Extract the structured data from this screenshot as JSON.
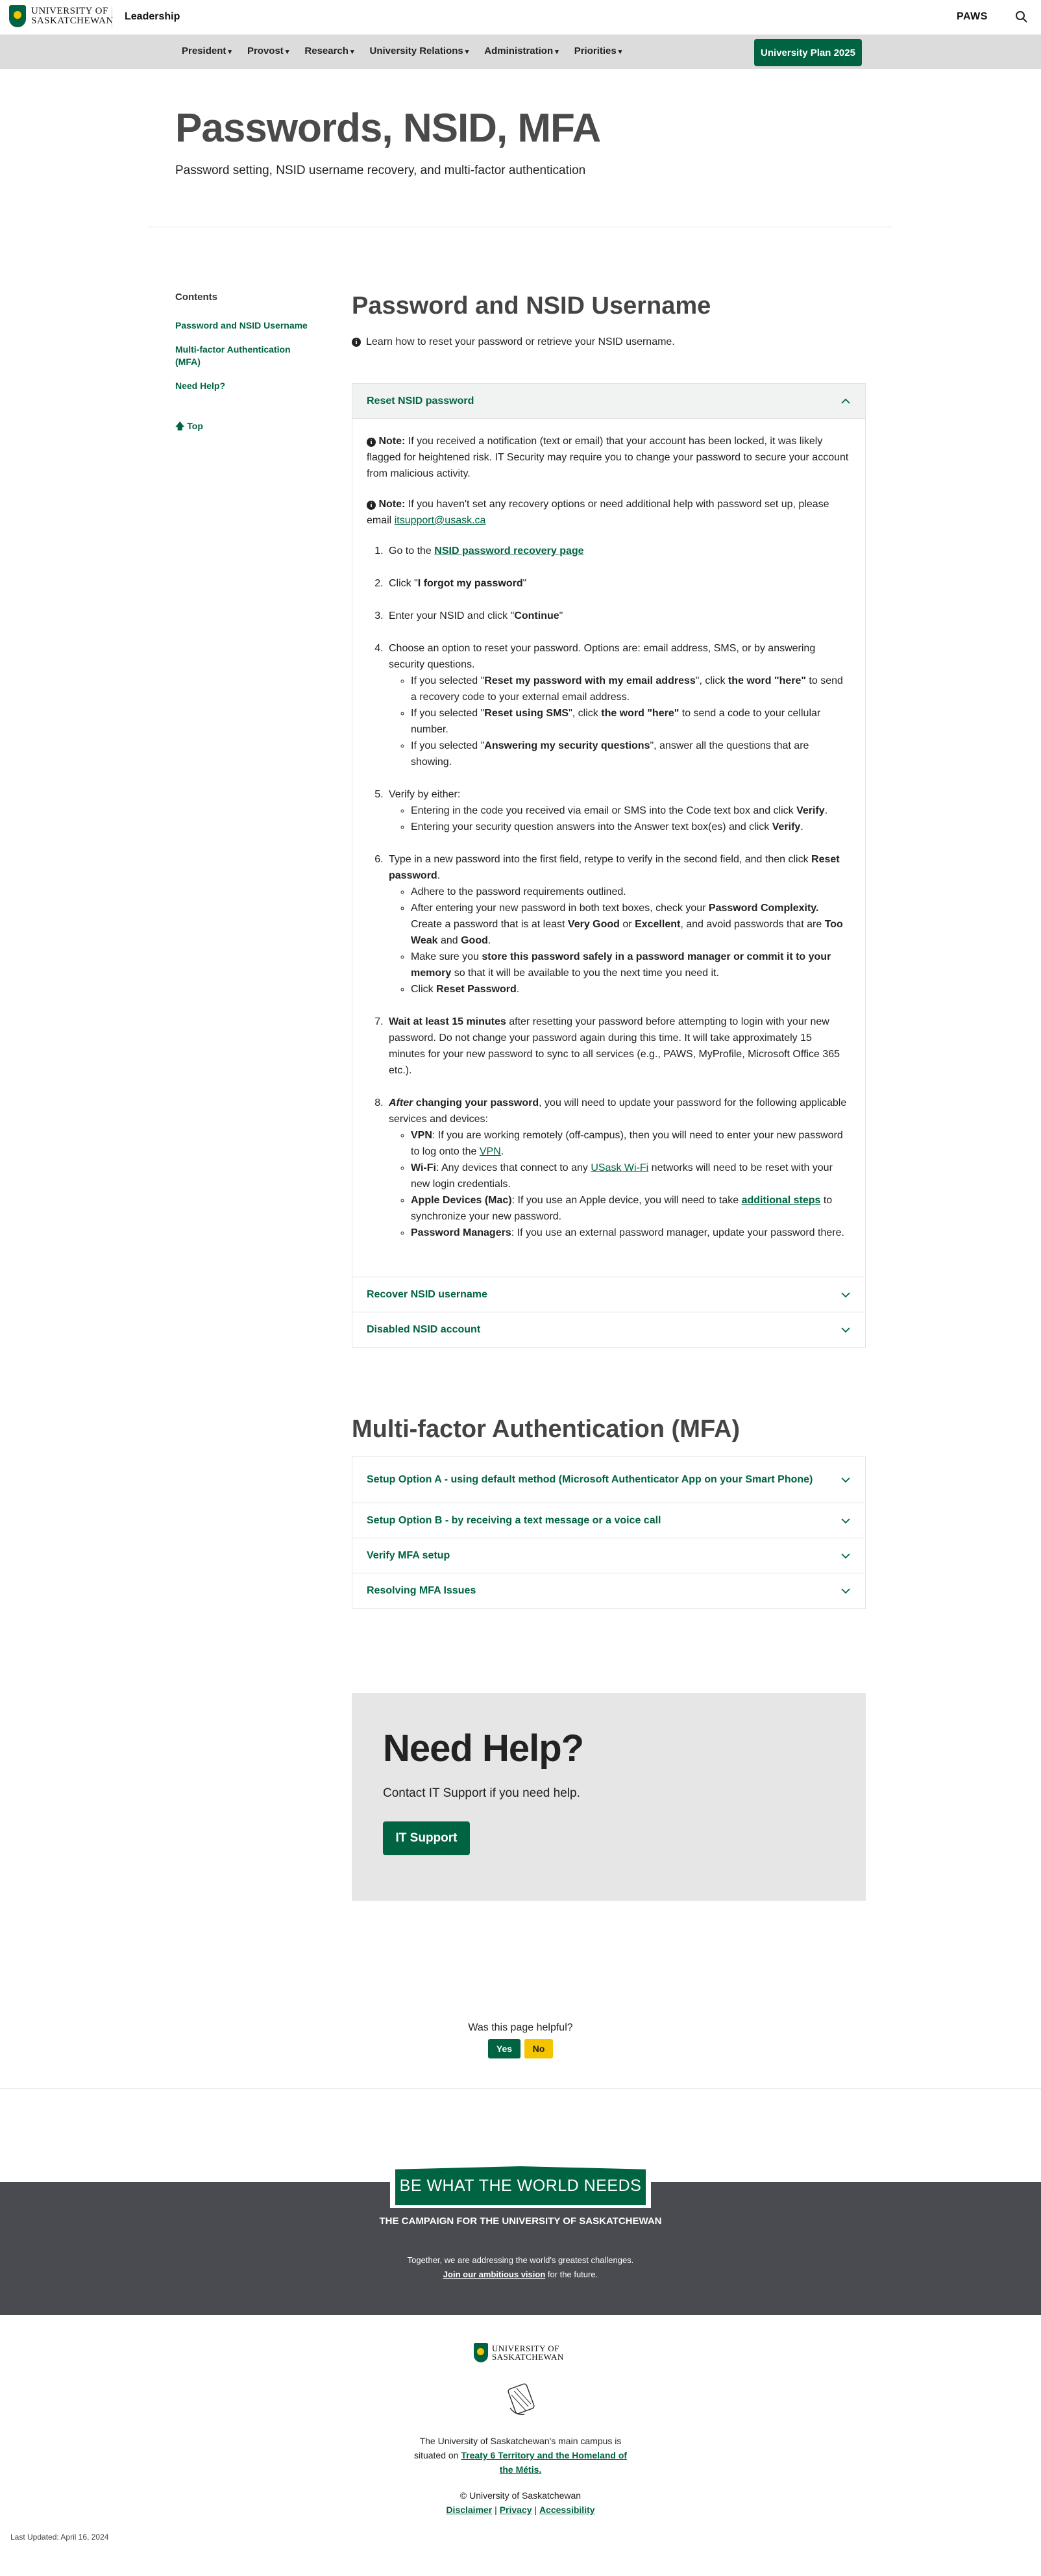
{
  "header": {
    "logo_line1": "UNIVERSITY OF",
    "logo_line2": "SASKATCHEWAN",
    "site_name": "Leadership",
    "paws_label": "PAWS"
  },
  "nav": {
    "items": [
      "President",
      "Provost",
      "Research",
      "University Relations",
      "Administration",
      "Priorities"
    ],
    "plan_button": "University Plan 2025"
  },
  "hero": {
    "title": "Passwords, NSID, MFA",
    "subtitle": "Password setting, NSID username recovery, and multi-factor authentication"
  },
  "sidebar": {
    "contents_title": "Contents",
    "links": [
      "Password and NSID Username",
      "Multi-factor Authentication (MFA)",
      "Need Help?"
    ],
    "top_label": "Top"
  },
  "section1": {
    "title": "Password and NSID Username",
    "intro": "Learn how to reset your password or retrieve your NSID username.",
    "accordion": [
      {
        "label": "Reset NSID password"
      },
      {
        "label": "Recover NSID username"
      },
      {
        "label": "Disabled NSID account"
      }
    ],
    "note1_label": "Note:",
    "note1_text": " If you received a notification (text or email) that your account has been locked, it was likely flagged for heightened risk. IT Security may require you to change your password to secure your account from malicious activity.",
    "note2_label": "Note:",
    "note2_text": " If you haven't set any recovery options or need additional help with password set up, please email ",
    "note2_email": "itsupport@usask.ca",
    "steps": {
      "s1_pre": "Go to the ",
      "s1_link": "NSID password recovery page",
      "s2_pre": "Click \"",
      "s2_bold": "I forgot my password",
      "s2_post": "\"",
      "s3_pre": "Enter your NSID and click \"",
      "s3_bold": "Continue",
      "s3_post": "\"",
      "s4_text": "Choose an option to reset your password.  Options are: email address, SMS, or by answering security questions.",
      "s4_b1_pre": "If you selected \"",
      "s4_b1_bold1": "Reset my password with my email address",
      "s4_b1_mid": "\", click ",
      "s4_b1_bold2": "the word \"here\"",
      "s4_b1_post": " to send a recovery code to your external email address.",
      "s4_b2_pre": "If you selected \"",
      "s4_b2_bold1": "Reset using SMS",
      "s4_b2_mid": "\", click ",
      "s4_b2_bold2": "the word \"here\"",
      "s4_b2_post": " to send a code to your cellular number.",
      "s4_b3_pre": "If you selected \"",
      "s4_b3_bold": "Answering my security questions",
      "s4_b3_post": "\", answer all the questions that are showing.",
      "s5_text": "Verify by either:",
      "s5_b1_pre": "Entering in the code you received via email or SMS into the Code text box and click ",
      "s5_b1_bold": "Verify",
      "s5_b1_post": ".",
      "s5_b2_pre": "Entering your security question answers into the Answer text box(es) and click ",
      "s5_b2_bold": "Verify",
      "s5_b2_post": ".",
      "s6_pre": "Type in a new password into the first field, retype to verify in the second field, and then click ",
      "s6_bold": "Reset password",
      "s6_post": ".",
      "s6_b1": "Adhere to the password requirements outlined.",
      "s6_b2_pre": "After entering your new password in both text boxes, check your ",
      "s6_b2_bold1": "Password Complexity.",
      "s6_b2_mid1": " Create a password that is at least ",
      "s6_b2_bold2": "Very Good",
      "s6_b2_mid2": " or ",
      "s6_b2_bold3": "Excellent",
      "s6_b2_mid3": ", and avoid passwords that are ",
      "s6_b2_bold4": "Too Weak",
      "s6_b2_mid4": " and ",
      "s6_b2_bold5": "Good",
      "s6_b2_post": ".",
      "s6_b3_pre": "Make sure you ",
      "s6_b3_bold": "store this password safely in a password manager or commit it to your memory",
      "s6_b3_post": " so that it will be available to you the next time you need it.",
      "s6_b4_pre": "Click ",
      "s6_b4_bold": "Reset Password",
      "s6_b4_post": ".",
      "s7_bold": "Wait at least 15 minutes",
      "s7_text": " after resetting your password before attempting to login with your new password. Do not change your password again during this time. It will take approximately 15 minutes for your new password to sync to all services (e.g., PAWS, MyProfile, Microsoft Office 365 etc.).",
      "s8_italic": "After",
      "s8_bold": " changing your password",
      "s8_text": ", you will need to update your password for the following applicable services and devices:",
      "s8_b1_bold": "VPN",
      "s8_b1_pre": ": If you are working remotely (off-campus), then you will need to enter your new password to log onto the ",
      "s8_b1_link": "VPN",
      "s8_b1_post": ".",
      "s8_b2_bold": "Wi-Fi",
      "s8_b2_pre": ": Any devices that connect to any ",
      "s8_b2_link": "USask Wi-Fi",
      "s8_b2_post": " networks will need to be reset with your new login credentials.",
      "s8_b3_bold": "Apple Devices (Mac)",
      "s8_b3_pre": ": If you use an Apple device, you will need to take ",
      "s8_b3_link": "additional steps",
      "s8_b3_post": " to synchronize your new password.",
      "s8_b4_bold": "Password Managers",
      "s8_b4_text": ": If you use an external password manager, update your password there."
    }
  },
  "section2": {
    "title": "Multi-factor Authentication (MFA)",
    "accordion": [
      {
        "label": "Setup Option A - using default method (Microsoft Authenticator App on your Smart Phone)"
      },
      {
        "label": "Setup Option B - by receiving a text message or a voice call"
      },
      {
        "label": "Verify MFA setup"
      },
      {
        "label": "Resolving MFA Issues"
      }
    ]
  },
  "help": {
    "title": "Need Help?",
    "text": "Contact IT Support if you need help.",
    "button": "IT Support"
  },
  "feedback": {
    "question": "Was this page helpful?",
    "yes": "Yes",
    "no": "No"
  },
  "campaign": {
    "badge": "BE WHAT THE WORLD NEEDS",
    "title": "THE CAMPAIGN FOR THE UNIVERSITY OF SASKATCHEWAN",
    "text": "Together, we are addressing the world's greatest challenges.",
    "link": "Join our ambitious vision",
    "text_post": " for the future."
  },
  "footer": {
    "logo_line1": "UNIVERSITY OF",
    "logo_line2": "SASKATCHEWAN",
    "land_line1": "The University of Saskatchewan's main campus is",
    "land_line2_pre": "situated on ",
    "land_link": "Treaty 6 Territory and the Homeland of the Métis.",
    "copyright": "© University of Saskatchewan",
    "links": [
      "Disclaimer",
      "Privacy",
      "Accessibility"
    ],
    "sep": " | ",
    "last_updated": "Last Updated: April 16, 2024"
  },
  "colors": {
    "brand_green": "#006341",
    "gold": "#f5c400",
    "campaign_bg": "#4a4b51",
    "help_bg": "#e6e6e6"
  }
}
